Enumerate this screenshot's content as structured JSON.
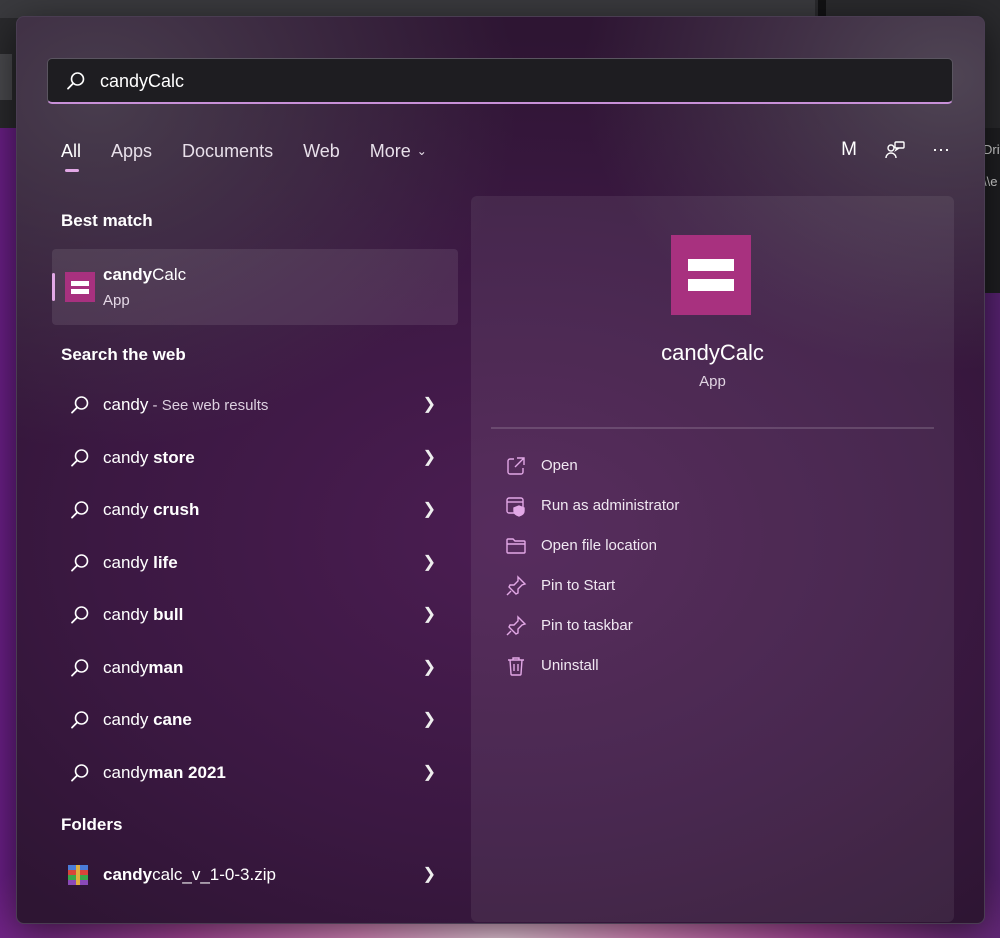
{
  "search": {
    "value": "candyCalc",
    "placeholder": ""
  },
  "tabs": [
    {
      "label": "All",
      "active": true
    },
    {
      "label": "Apps"
    },
    {
      "label": "Documents"
    },
    {
      "label": "Web"
    },
    {
      "label": "More"
    }
  ],
  "header_icons": {
    "avatar_letter": "M",
    "feedback_icon": "share-feedback-icon",
    "more_icon": "ellipsis-icon"
  },
  "sections": {
    "best_match": "Best match",
    "search_web": "Search the web",
    "folders": "Folders"
  },
  "best_match": {
    "name_prefix": "candy",
    "name_bold": "Calc",
    "type": "App"
  },
  "web_results": [
    {
      "plain": "candy",
      "bold": "",
      "sub": " - See web results"
    },
    {
      "plain": "candy ",
      "bold": "store",
      "sub": ""
    },
    {
      "plain": "candy ",
      "bold": "crush",
      "sub": ""
    },
    {
      "plain": "candy ",
      "bold": "life",
      "sub": ""
    },
    {
      "plain": "candy ",
      "bold": "bull",
      "sub": ""
    },
    {
      "plain": "candy",
      "bold": "man",
      "sub": ""
    },
    {
      "plain": "candy ",
      "bold": "cane",
      "sub": ""
    },
    {
      "plain": "candy",
      "bold": "man 2021",
      "sub": ""
    }
  ],
  "folder_result": {
    "bold": "candy",
    "plain": "calc_v_1-0-3.zip",
    "icon": "winrar-archive-icon"
  },
  "preview": {
    "name": "candyCalc",
    "type": "App",
    "actions": [
      {
        "label": "Open",
        "icon": "open-external-icon"
      },
      {
        "label": "Run as administrator",
        "icon": "shield-admin-icon"
      },
      {
        "label": "Open file location",
        "icon": "folder-icon"
      },
      {
        "label": "Pin to Start",
        "icon": "pin-icon"
      },
      {
        "label": "Pin to taskbar",
        "icon": "pin-icon"
      },
      {
        "label": "Uninstall",
        "icon": "trash-icon"
      }
    ]
  },
  "background_text": {
    "line1": "Driv",
    "line2": "\\\\e"
  },
  "colors": {
    "accent": "#e2a8e6",
    "app_icon": "#a8317f",
    "panel": "#3b1842"
  }
}
